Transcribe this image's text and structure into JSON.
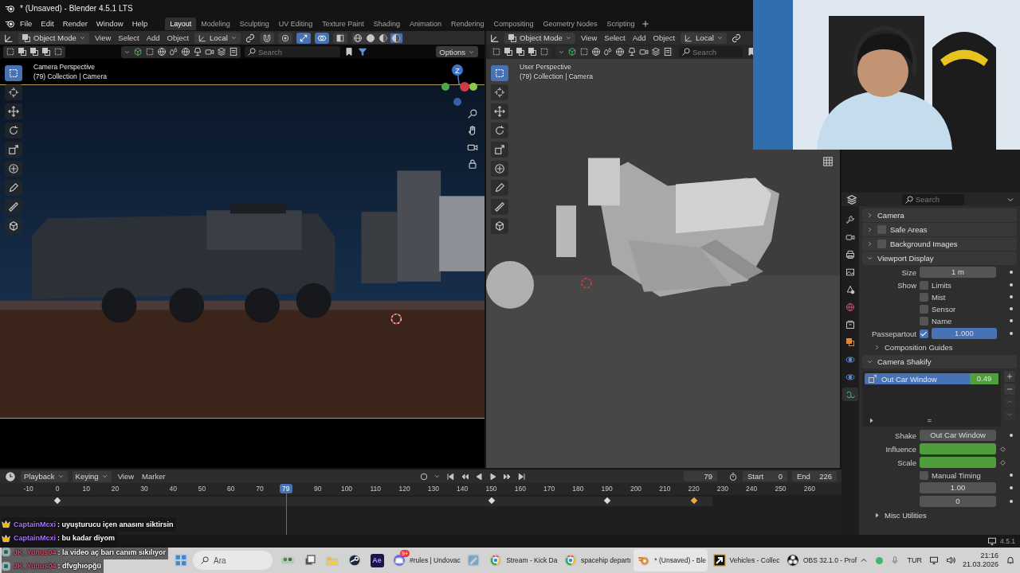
{
  "window": {
    "title": "* (Unsaved) - Blender 4.5.1 LTS"
  },
  "menu": [
    "File",
    "Edit",
    "Render",
    "Window",
    "Help"
  ],
  "workspaces": [
    {
      "label": "Layout",
      "selected": true
    },
    {
      "label": "Modeling",
      "selected": false
    },
    {
      "label": "Sculpting",
      "selected": false
    },
    {
      "label": "UV Editing",
      "selected": false
    },
    {
      "label": "Texture Paint",
      "selected": false
    },
    {
      "label": "Shading",
      "selected": false
    },
    {
      "label": "Animation",
      "selected": false
    },
    {
      "label": "Rendering",
      "selected": false
    },
    {
      "label": "Compositing",
      "selected": false
    },
    {
      "label": "Geometry Nodes",
      "selected": false
    },
    {
      "label": "Scripting",
      "selected": false
    }
  ],
  "viewports": [
    {
      "kind": "camera",
      "mode": "Object Mode",
      "menus": [
        "View",
        "Select",
        "Add",
        "Object"
      ],
      "orientation": "Local",
      "toggles": [
        {
          "kind": "snap",
          "on": false
        },
        {
          "kind": "proportional",
          "on": false
        },
        {
          "kind": "gizmo",
          "on": true
        },
        {
          "kind": "overlay",
          "on": true
        },
        {
          "kind": "xray",
          "on": false
        }
      ],
      "shading": [
        {
          "kind": "wireframe",
          "selected": false
        },
        {
          "kind": "solid",
          "selected": false
        },
        {
          "kind": "material",
          "selected": false
        },
        {
          "kind": "rendered",
          "selected": true
        }
      ],
      "search_placeholder": "Search",
      "options": "Options",
      "overlay_title": "Camera Perspective",
      "overlay_subtitle": "(79) Collection | Camera",
      "gizmo_labels": [
        "Z"
      ],
      "tools": [
        {
          "kind": "select",
          "selected": true
        },
        {
          "kind": "cursor",
          "selected": false
        },
        {
          "kind": "move",
          "selected": false
        },
        {
          "kind": "rotate",
          "selected": false
        },
        {
          "kind": "scale",
          "selected": false
        },
        {
          "kind": "transform",
          "selected": false
        },
        {
          "kind": "annotate",
          "selected": false
        },
        {
          "kind": "measure",
          "selected": false
        },
        {
          "kind": "add",
          "selected": false
        }
      ]
    },
    {
      "kind": "user",
      "mode": "Object Mode",
      "menus": [
        "View",
        "Select",
        "Add",
        "Object"
      ],
      "orientation": "Local",
      "search_placeholder": "Search",
      "overlay_title": "User Perspective",
      "overlay_subtitle": "(79) Collection | Camera",
      "tools": [
        {
          "kind": "select",
          "selected": true
        },
        {
          "kind": "cursor",
          "selected": false
        },
        {
          "kind": "move",
          "selected": false
        },
        {
          "kind": "rotate",
          "selected": false
        },
        {
          "kind": "scale",
          "selected": false
        },
        {
          "kind": "transform",
          "selected": false
        },
        {
          "kind": "annotate",
          "selected": false
        },
        {
          "kind": "measure",
          "selected": false
        },
        {
          "kind": "add",
          "selected": false
        }
      ]
    }
  ],
  "properties": {
    "search_placeholder": "Search",
    "tabs": [
      {
        "kind": "tool",
        "selected": false
      },
      {
        "kind": "render",
        "selected": false
      },
      {
        "kind": "output",
        "selected": false
      },
      {
        "kind": "view_layer",
        "selected": false
      },
      {
        "kind": "scene",
        "selected": false
      },
      {
        "kind": "world",
        "selected": false
      },
      {
        "kind": "collection",
        "selected": false
      },
      {
        "kind": "object",
        "selected": false
      },
      {
        "kind": "physics",
        "selected": false
      },
      {
        "kind": "constraints",
        "selected": false
      },
      {
        "kind": "data",
        "selected": true
      }
    ],
    "panels": [
      {
        "kind": "header",
        "title": "Camera",
        "expanded": false
      },
      {
        "kind": "header",
        "title": "Safe Areas",
        "expanded": false,
        "checked": false
      },
      {
        "kind": "header",
        "title": "Background Images",
        "expanded": false,
        "checked": false
      },
      {
        "kind": "header",
        "title": "Viewport Display",
        "expanded": true
      },
      {
        "kind": "field",
        "label": "Size",
        "value": "1 m"
      },
      {
        "kind": "check",
        "label": "Show",
        "option": "Limits",
        "checked": false
      },
      {
        "kind": "check",
        "option": "Mist",
        "checked": false
      },
      {
        "kind": "check",
        "option": "Sensor",
        "checked": false
      },
      {
        "kind": "check",
        "option": "Name",
        "checked": false
      },
      {
        "kind": "slider",
        "label": "Passepartout",
        "checked": true,
        "value": "1.000",
        "level": 1
      },
      {
        "kind": "subheader",
        "title": "Composition Guides",
        "expanded": false
      },
      {
        "kind": "header",
        "title": "Camera Shakify",
        "expanded": true
      },
      {
        "kind": "list",
        "items": [
          {
            "name": "Out Car Window",
            "value": "0.49",
            "selected": true
          }
        ]
      },
      {
        "kind": "field",
        "label": "Shake",
        "value": "Out Car Window"
      },
      {
        "kind": "keyed",
        "label": "Influence"
      },
      {
        "kind": "keyed",
        "label": "Scale"
      },
      {
        "kind": "check",
        "option": "Manual Timing",
        "checked": false
      },
      {
        "kind": "field",
        "value": "1.00"
      },
      {
        "kind": "field",
        "value": "0"
      },
      {
        "kind": "subheader",
        "title": "Misc Utilities",
        "expanded": false
      }
    ]
  },
  "timeline": {
    "dropdowns": [
      "Playback",
      "Keying"
    ],
    "menus": [
      "View",
      "Marker"
    ],
    "current_frame": "79",
    "start_label": "Start",
    "start": "0",
    "end_label": "End",
    "end": "226",
    "ruler_before": [
      "-10",
      "0",
      "10",
      "20",
      "30",
      "40",
      "50",
      "60",
      "70"
    ],
    "playhead": {
      "label": "79",
      "level": 0.3397
    },
    "ruler_after": [
      "90",
      "100",
      "110",
      "120",
      "130",
      "140",
      "150",
      "160",
      "170",
      "180",
      "190",
      "200",
      "210",
      "220",
      "230",
      "240",
      "250",
      "260"
    ],
    "keyframes": [
      {
        "level": 0.0681,
        "selected": false
      },
      {
        "level": 0.584,
        "selected": false
      },
      {
        "level": 0.7215,
        "selected": false
      },
      {
        "level": 0.8246,
        "selected": true
      }
    ]
  },
  "status_bar": {
    "version": "4.5.1"
  },
  "chat": [
    {
      "kind": "crown",
      "user": "CaptainMcxi",
      "color": "#a970ff",
      "message": ": uyuşturucu içen anasını siktirsin"
    },
    {
      "kind": "crown",
      "user": "CaptainMcxi",
      "color": "#a970ff",
      "message": ": bu kadar diyom"
    },
    {
      "kind": "sub",
      "user": "JK_Yunus04",
      "color": "#d4506e",
      "message": ": la video aç barı canım sıkılıyor"
    },
    {
      "kind": "sub",
      "user": "JK_Yunus04",
      "color": "#d4506e",
      "message": ": dfvghıopğü"
    }
  ],
  "taskbar": {
    "search_placeholder": "Ara",
    "items": [
      {
        "kind": "widgets",
        "selected": false
      },
      {
        "kind": "taskview",
        "selected": false
      },
      {
        "kind": "explorer",
        "selected": false
      },
      {
        "kind": "steam",
        "selected": false
      },
      {
        "kind": "ae",
        "label": "Ae",
        "selected": false
      },
      {
        "kind": "discord",
        "label": "#rules | Undovac",
        "badge": "9+",
        "selected": false
      },
      {
        "kind": "app",
        "selected": false
      },
      {
        "kind": "chrome",
        "label": "Stream - Kick Da",
        "selected": false
      },
      {
        "kind": "chrome",
        "label": "spacehip departı",
        "selected": false
      },
      {
        "kind": "blender",
        "label": "* (Unsaved) - Ble",
        "selected": true
      },
      {
        "kind": "vehicles",
        "label": "Vehicles - Collec",
        "selected": false
      },
      {
        "kind": "obs",
        "label": "OBS 32.1.0 - Prof",
        "selected": false
      }
    ],
    "language": "TUR",
    "time": "21:16",
    "date": "21.03.2026"
  }
}
